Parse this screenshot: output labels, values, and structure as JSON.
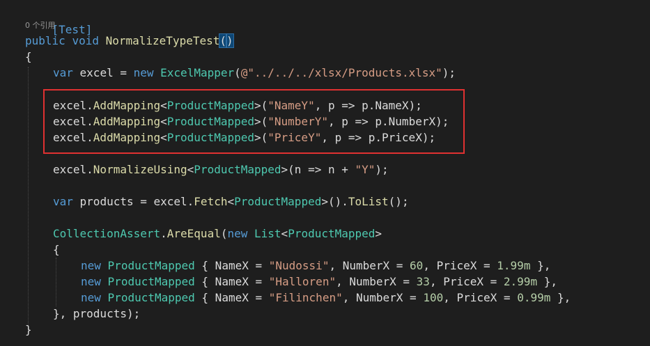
{
  "codelens": {
    "references": "0 个引用"
  },
  "lines": {
    "l1": [
      "[Test]"
    ],
    "l2": [
      "public",
      " ",
      "void",
      " ",
      "NormalizeTypeTest",
      "(",
      ")"
    ],
    "l3": [
      "{"
    ],
    "l4": [
      "var",
      " excel = ",
      "new",
      " ",
      "ExcelMapper",
      "(",
      "@\"../../../xlsx/Products.xlsx\"",
      ");"
    ],
    "l5": [
      "excel.",
      "AddMapping",
      "<",
      "ProductMapped",
      ">(",
      "\"NameY\"",
      ", p => p.NameX);"
    ],
    "l6": [
      "excel.",
      "AddMapping",
      "<",
      "ProductMapped",
      ">(",
      "\"NumberY\"",
      ", p => p.NumberX);"
    ],
    "l7": [
      "excel.",
      "AddMapping",
      "<",
      "ProductMapped",
      ">(",
      "\"PriceY\"",
      ", p => p.PriceX);"
    ],
    "l8": [
      "excel.",
      "NormalizeUsing",
      "<",
      "ProductMapped",
      ">(n => n + ",
      "\"Y\"",
      ");"
    ],
    "l9": [
      "var",
      " products = excel.",
      "Fetch",
      "<",
      "ProductMapped",
      ">().",
      "ToList",
      "();"
    ],
    "l10": [
      "CollectionAssert",
      ".",
      "AreEqual",
      "(",
      "new",
      " ",
      "List",
      "<",
      "ProductMapped",
      ">"
    ],
    "l11": [
      "{"
    ],
    "l12": [
      "new",
      " ",
      "ProductMapped",
      " { NameX = ",
      "\"Nudossi\"",
      ", NumberX = ",
      "60",
      ", PriceX = ",
      "1.99m",
      " },"
    ],
    "l13": [
      "new",
      " ",
      "ProductMapped",
      " { NameX = ",
      "\"Halloren\"",
      ", NumberX = ",
      "33",
      ", PriceX = ",
      "2.99m",
      " },"
    ],
    "l14": [
      "new",
      " ",
      "ProductMapped",
      " { NameX = ",
      "\"Filinchen\"",
      ", NumberX = ",
      "100",
      ", PriceX = ",
      "0.99m",
      " },"
    ],
    "l15": [
      "}, products);"
    ],
    "l16": [
      "}"
    ]
  },
  "colors": {
    "background": "#1e1e1e",
    "keyword": "#569cd6",
    "type": "#4ec9b0",
    "string": "#d69d85",
    "number": "#b5cea8",
    "method": "#dcdcaa",
    "text": "#dcdcdc",
    "highlight_box": "#e03131"
  }
}
